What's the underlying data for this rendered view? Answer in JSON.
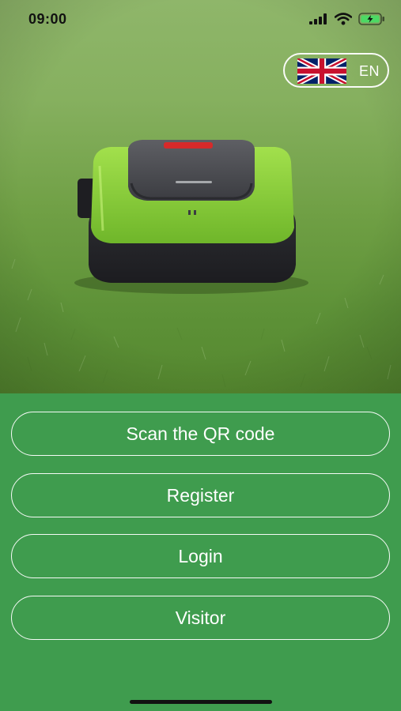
{
  "status_bar": {
    "time": "09:00",
    "signal_icon": "cellular-signal-icon",
    "wifi_icon": "wifi-icon",
    "battery_icon": "battery-charging-icon"
  },
  "language": {
    "code": "EN",
    "flag_icon": "uk-flag-icon"
  },
  "hero": {
    "image": "robotic-lawn-mower-on-grass"
  },
  "actions": {
    "scan_label": "Scan the QR code",
    "register_label": "Register",
    "login_label": "Login",
    "visitor_label": "Visitor"
  },
  "colors": {
    "panel": "#3f9c4e",
    "button_border": "#ffffff",
    "text": "#ffffff",
    "mower_body": "#8fd13a",
    "mower_base": "#2a2a2e"
  }
}
